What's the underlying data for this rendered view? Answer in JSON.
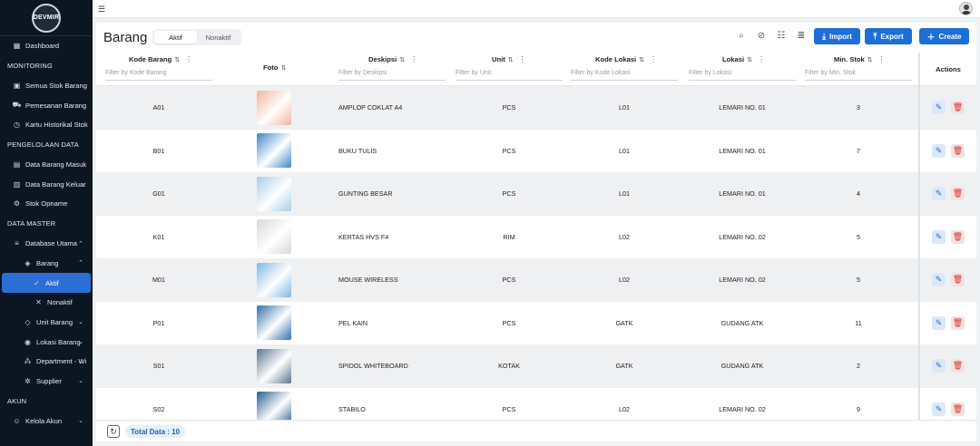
{
  "app": {
    "logo_text": "DEVMIR"
  },
  "sidebar": {
    "items": [
      {
        "type": "item",
        "label": "Dashboard",
        "icon": "dashboard-icon"
      },
      {
        "type": "section",
        "label": "MONITORING"
      },
      {
        "type": "item",
        "label": "Semua Stok Barang",
        "icon": "boxes-icon"
      },
      {
        "type": "item",
        "label": "Pemesanan Barang",
        "icon": "cart-icon"
      },
      {
        "type": "item",
        "label": "Kartu Historikal Stok",
        "icon": "history-icon"
      },
      {
        "type": "section",
        "label": "PENGELOLAAN DATA"
      },
      {
        "type": "item",
        "label": "Data Barang Masuk",
        "icon": "inbox-icon"
      },
      {
        "type": "item",
        "label": "Data Barang Keluar",
        "icon": "outbox-icon"
      },
      {
        "type": "item",
        "label": "Stok Opname",
        "icon": "settings-icon"
      },
      {
        "type": "section",
        "label": "DATA MASTER"
      },
      {
        "type": "item",
        "label": "Database Utama",
        "icon": "database-icon",
        "expanded": true
      },
      {
        "type": "sub",
        "label": "Barang",
        "icon": "cube-icon",
        "expanded": true
      },
      {
        "type": "active",
        "label": "Aktif",
        "icon": "check-icon"
      },
      {
        "type": "sub2",
        "label": "Nonaktif",
        "icon": "x-icon"
      },
      {
        "type": "sub",
        "label": "Unit Barang",
        "icon": "tag-icon",
        "expanded": false
      },
      {
        "type": "sub",
        "label": "Lokasi Barang",
        "icon": "location-icon",
        "expanded": false
      },
      {
        "type": "sub",
        "label": "Department - Wi",
        "icon": "network-icon",
        "expanded": false
      },
      {
        "type": "sub",
        "label": "Supplier",
        "icon": "gear-icon",
        "expanded": false
      },
      {
        "type": "section",
        "label": "AKUN"
      },
      {
        "type": "item",
        "label": "Kelola Akun",
        "icon": "user-icon",
        "expanded": false
      }
    ]
  },
  "header": {
    "title": "Barang",
    "tabs": [
      "Aktif",
      "Nonaktif"
    ],
    "active_tab": "Aktif",
    "import_label": "Import",
    "export_label": "Export",
    "create_label": "Create"
  },
  "table": {
    "columns": [
      {
        "key": "kode",
        "label": "Kode Barang",
        "filter": "Filter by Kode Barang"
      },
      {
        "key": "foto",
        "label": "Foto",
        "filter": ""
      },
      {
        "key": "deskripsi",
        "label": "Deskipsi",
        "filter": "Filter by Deskipsi"
      },
      {
        "key": "unit",
        "label": "Unit",
        "filter": "Filter by Unit"
      },
      {
        "key": "kode_lokasi",
        "label": "Kode Lokasi",
        "filter": "Filter by Kode Lokasi"
      },
      {
        "key": "lokasi",
        "label": "Lokasi",
        "filter": "Filter by Lokasi"
      },
      {
        "key": "min_stok",
        "label": "Min. Stok",
        "filter": "Filter by Min. Stok"
      }
    ],
    "actions_label": "Actions",
    "rows": [
      {
        "kode": "A01",
        "deskripsi": "AMPLOP COKLAT A4",
        "unit": "PCS",
        "kode_lokasi": "L01",
        "lokasi": "LEMARI NO. 01",
        "min_stok": "3",
        "photo_color": "#f0b59a"
      },
      {
        "kode": "B01",
        "deskripsi": "BUKU TULIS",
        "unit": "PCS",
        "kode_lokasi": "L01",
        "lokasi": "LEMARI NO. 01",
        "min_stok": "7",
        "photo_color": "#3b87c9"
      },
      {
        "kode": "G01",
        "deskripsi": "GUNTING BESAR",
        "unit": "PCS",
        "kode_lokasi": "L01",
        "lokasi": "LEMARI NO. 01",
        "min_stok": "4",
        "photo_color": "#a8cde6"
      },
      {
        "kode": "K01",
        "deskripsi": "KERTAS HVS F4",
        "unit": "RIM",
        "kode_lokasi": "L02",
        "lokasi": "LEMARI NO. 02",
        "min_stok": "5",
        "photo_color": "#d8d8d8"
      },
      {
        "kode": "M01",
        "deskripsi": "MOUSE WIRELESS",
        "unit": "PCS",
        "kode_lokasi": "L02",
        "lokasi": "LEMARI NO. 02",
        "min_stok": "5",
        "photo_color": "#7fb6e0"
      },
      {
        "kode": "P01",
        "deskripsi": "PEL KAIN",
        "unit": "PCS",
        "kode_lokasi": "GATK",
        "lokasi": "GUDANG ATK",
        "min_stok": "11",
        "photo_color": "#2f6fae"
      },
      {
        "kode": "S01",
        "deskripsi": "SPIDOL WHITEBOARD",
        "unit": "KOTAK",
        "kode_lokasi": "GATK",
        "lokasi": "GUDANG ATK",
        "min_stok": "2",
        "photo_color": "#5a7590"
      },
      {
        "kode": "S02",
        "deskripsi": "STABILO",
        "unit": "PCS",
        "kode_lokasi": "L02",
        "lokasi": "LEMARI NO. 02",
        "min_stok": "9",
        "photo_color": "#2a5c8c"
      }
    ]
  },
  "footer": {
    "total_label": "Total Data : 10"
  }
}
